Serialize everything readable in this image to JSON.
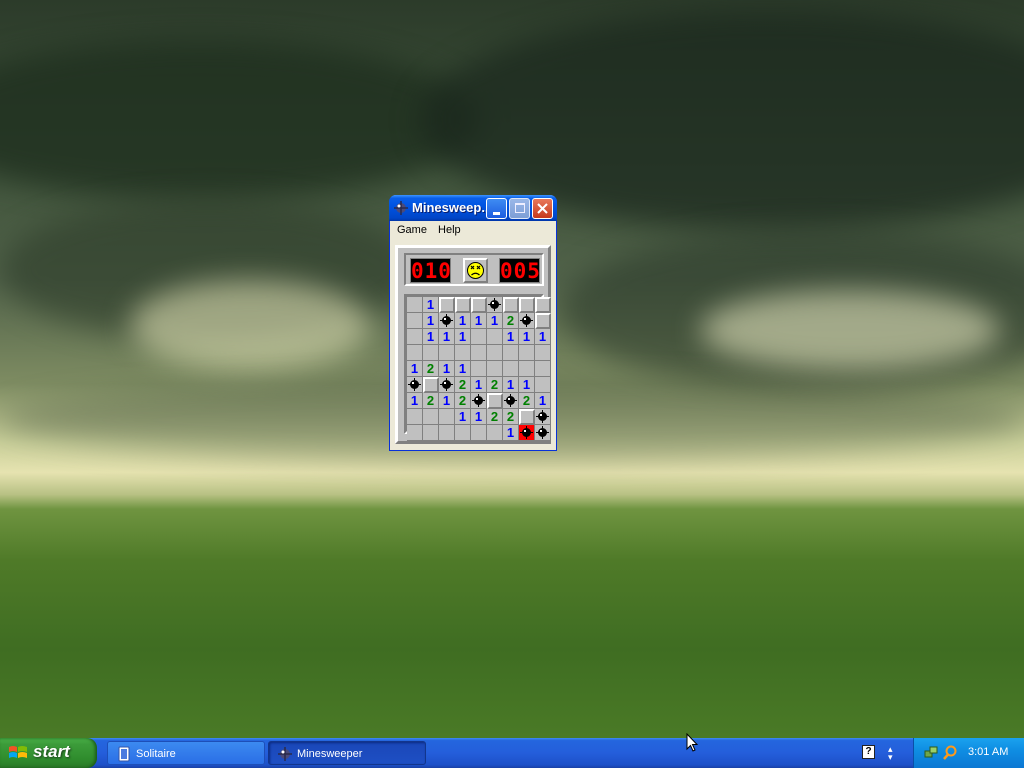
{
  "window": {
    "title": "Minesweep...",
    "menu": [
      "Game",
      "Help"
    ],
    "mine_counter": "010",
    "timer": "005",
    "face_state": "sad",
    "board": {
      "cols": 9,
      "rows": 9,
      "cells": [
        [
          "",
          "1",
          "C",
          "C",
          "C",
          "M",
          "C",
          "C",
          "C"
        ],
        [
          "",
          "1",
          "M",
          "1",
          "1",
          "1",
          "2",
          "M",
          "C"
        ],
        [
          "",
          "1",
          "1",
          "1",
          "",
          "",
          "1",
          "1",
          "1"
        ],
        [
          "",
          "",
          "",
          "",
          "",
          "",
          "",
          "",
          ""
        ],
        [
          "1",
          "2",
          "1",
          "1",
          "",
          "",
          "",
          "",
          ""
        ],
        [
          "M",
          "C",
          "M",
          "2",
          "1",
          "2",
          "1",
          "1",
          ""
        ],
        [
          "1",
          "2",
          "1",
          "2",
          "M",
          "C",
          "M",
          "2",
          "1"
        ],
        [
          "",
          "",
          "",
          "1",
          "1",
          "2",
          "2",
          "C",
          "M"
        ],
        [
          "",
          "",
          "",
          "",
          "",
          "",
          "1",
          "X",
          "M"
        ]
      ]
    }
  },
  "taskbar": {
    "start_label": "start",
    "tasks": [
      {
        "label": "Solitaire",
        "active": false
      },
      {
        "label": "Minesweeper",
        "active": true
      }
    ],
    "clock": "3:01 AM",
    "help_glyph": "?"
  },
  "colors": {
    "title_bar": "#0054e3",
    "taskbar": "#245edb",
    "start_button": "#3c9c3a",
    "lcd_digits": "#ff0000",
    "number_1": "#0000ff",
    "number_2": "#008000"
  },
  "icons": [
    "minesweeper-icon",
    "minimize-icon",
    "maximize-icon",
    "close-icon",
    "sad-face-icon",
    "mine-icon",
    "windows-flag-icon",
    "solitaire-icon",
    "help-icon",
    "network-icon",
    "search-icon",
    "mouse-cursor-icon"
  ]
}
